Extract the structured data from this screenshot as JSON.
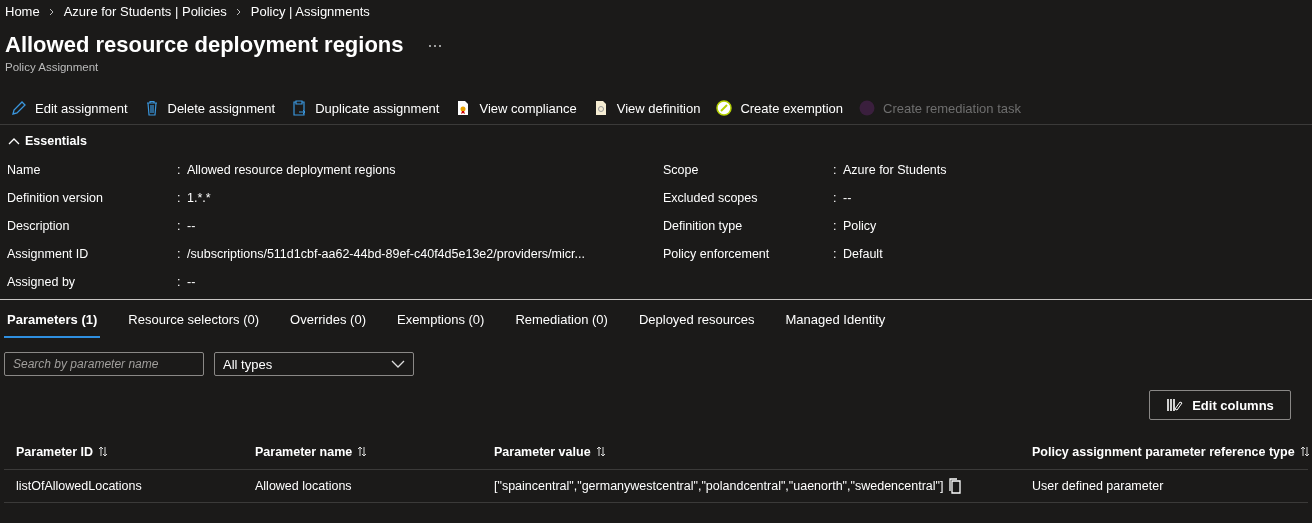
{
  "breadcrumb": [
    "Home",
    "Azure for Students | Policies",
    "Policy | Assignments"
  ],
  "title": "Allowed resource deployment regions",
  "subtitle": "Policy Assignment",
  "commands": [
    {
      "kind": "edit",
      "label": "Edit assignment",
      "disabled": false
    },
    {
      "kind": "delete",
      "label": "Delete assignment",
      "disabled": false
    },
    {
      "kind": "duplicate",
      "label": "Duplicate assignment",
      "disabled": false
    },
    {
      "kind": "compliance",
      "label": "View compliance",
      "disabled": false
    },
    {
      "kind": "definition",
      "label": "View definition",
      "disabled": false
    },
    {
      "kind": "exemption",
      "label": "Create exemption",
      "disabled": false
    },
    {
      "kind": "remediation",
      "label": "Create remediation task",
      "disabled": true
    }
  ],
  "essentials": {
    "title": "Essentials",
    "expanded": true,
    "separator": ":",
    "left": [
      {
        "label": "Name",
        "value": "Allowed resource deployment regions"
      },
      {
        "label": "Definition version",
        "value": "1.*.*"
      },
      {
        "label": "Description",
        "value": "--"
      },
      {
        "label": "Assignment ID",
        "value": "/subscriptions/511d1cbf-aa62-44bd-89ef-c40f4d5e13e2/providers/micr..."
      },
      {
        "label": "Assigned by",
        "value": "--"
      }
    ],
    "right": [
      {
        "label": "Scope",
        "value": "Azure for Students"
      },
      {
        "label": "Excluded scopes",
        "value": "--"
      },
      {
        "label": "Definition type",
        "value": "Policy"
      },
      {
        "label": "Policy enforcement",
        "value": "Default"
      }
    ]
  },
  "tabs": [
    {
      "label": "Parameters (1)",
      "selected": true
    },
    {
      "label": "Resource selectors (0)",
      "selected": false
    },
    {
      "label": "Overrides (0)",
      "selected": false
    },
    {
      "label": "Exemptions (0)",
      "selected": false
    },
    {
      "label": "Remediation (0)",
      "selected": false
    },
    {
      "label": "Deployed resources",
      "selected": false
    },
    {
      "label": "Managed Identity",
      "selected": false
    }
  ],
  "search": {
    "placeholder": "Search by parameter name"
  },
  "type_filter": {
    "value": "All types"
  },
  "edit_columns_button": "Edit columns",
  "table": {
    "columns": [
      "Parameter ID",
      "Parameter name",
      "Parameter value",
      "Policy assignment parameter reference type"
    ],
    "rows": [
      [
        "listOfAllowedLocations",
        "Allowed locations",
        "[\"spaincentral\",\"germanywestcentral\",\"polandcentral\",\"uaenorth\",\"swedencentral\"]",
        "User defined parameter"
      ]
    ]
  }
}
